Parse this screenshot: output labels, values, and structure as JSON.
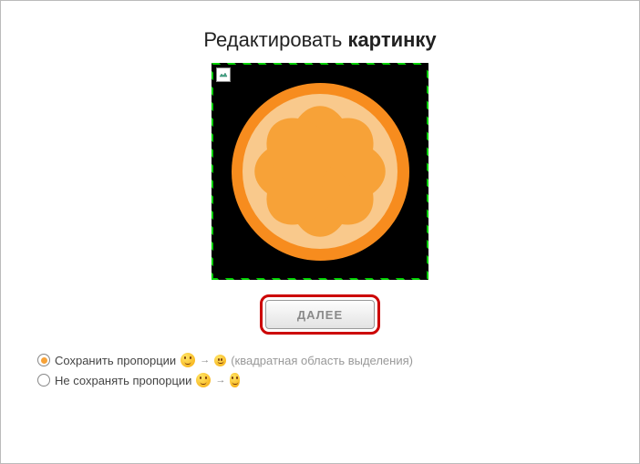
{
  "title": {
    "part1": "Редактировать",
    "part2": "картинку"
  },
  "button": {
    "next": "ДАЛЕЕ"
  },
  "options": {
    "keep": "Сохранить пропорции",
    "nokeep": "Не сохранять пропорции",
    "hint": "(квадратная область выделения)",
    "arrow": "→"
  }
}
